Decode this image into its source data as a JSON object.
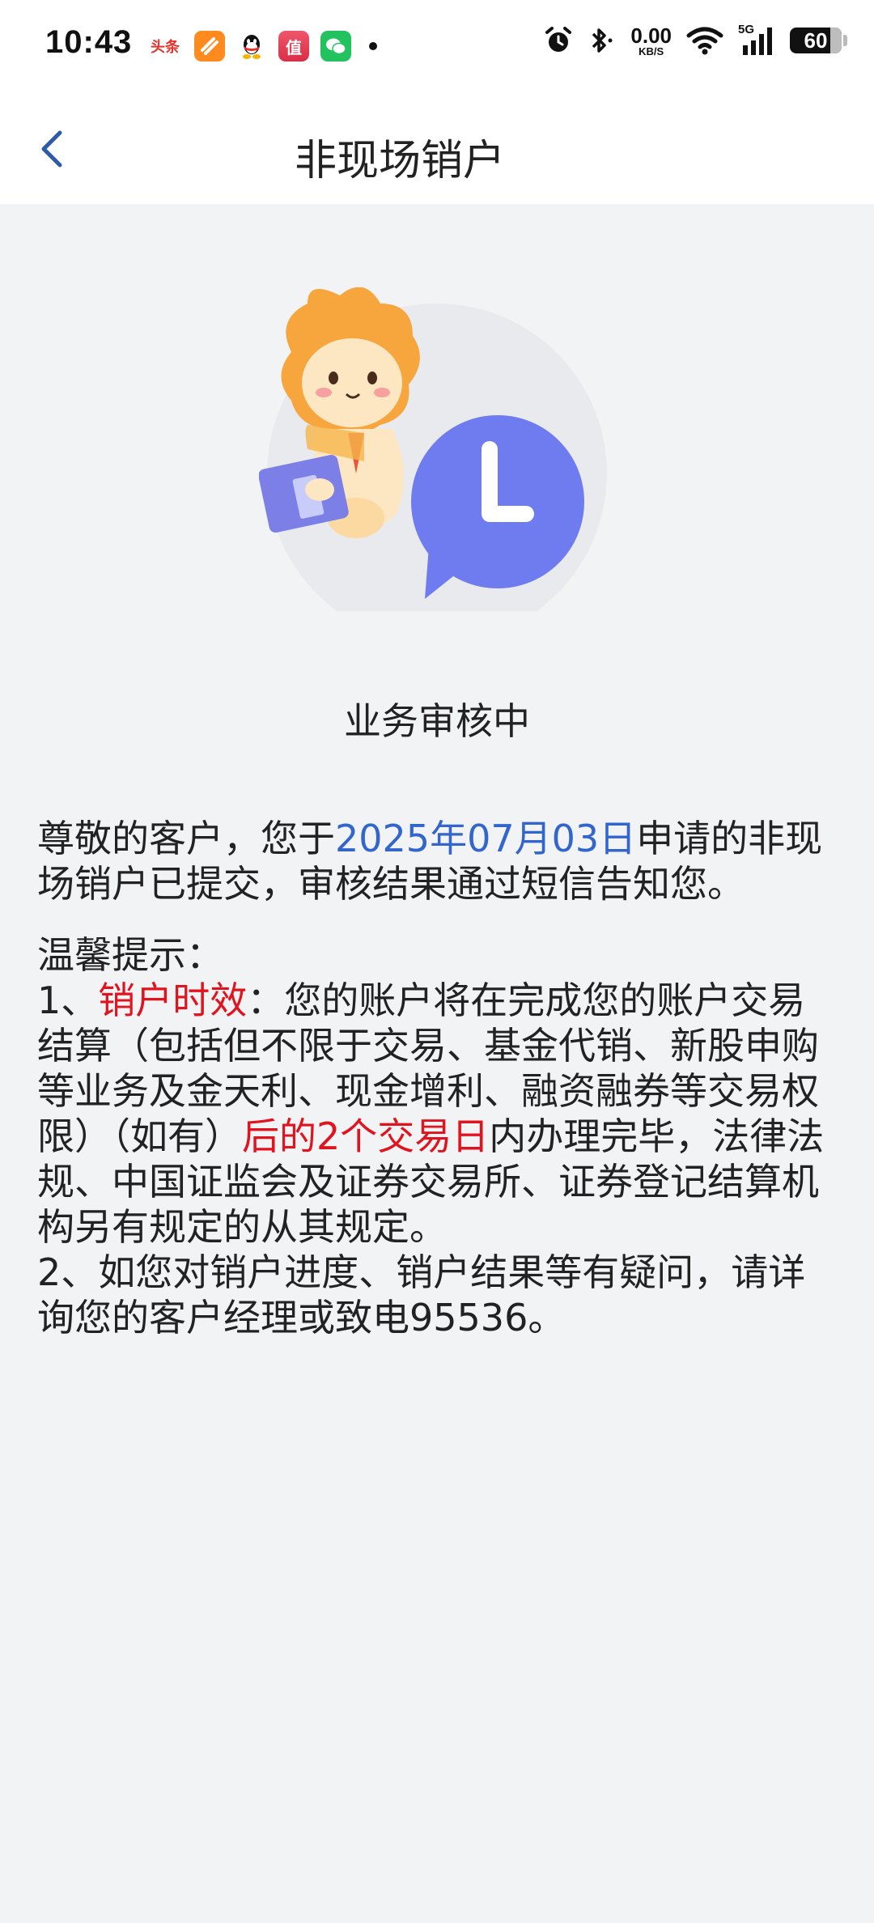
{
  "status_bar": {
    "time": "10:43",
    "apps": [
      {
        "name": "toutiao-app-icon",
        "label": "头条",
        "color": "#e8332b"
      },
      {
        "name": "orange-app-icon",
        "label": "",
        "color": "#ff8a1e"
      },
      {
        "name": "qq-app-icon",
        "label": "",
        "color": "#ffffff"
      },
      {
        "name": "zhi-app-icon",
        "label": "值",
        "color": "#e8334b"
      },
      {
        "name": "wechat-app-icon",
        "label": "",
        "color": "#22c35e"
      }
    ],
    "net_speed_value": "0.00",
    "net_speed_unit": "KB/S",
    "signal_label": "5G",
    "battery": "60"
  },
  "nav": {
    "title": "非现场销户"
  },
  "status": {
    "text": "业务审核中"
  },
  "message": {
    "p1_prefix": "尊敬的客户，您于",
    "p1_date": "2025年07月03日",
    "p1_suffix": "申请的非现场销户已提交，审核结果通过短信告知您。",
    "tips_title": "温馨提示：",
    "tip1_num": "1、",
    "tip1_highlight": "销户时效",
    "tip1_mid": "：您的账户将在完成您的账户交易结算（包括但不限于交易、基金代销、新股申购等业务及金天利、现金增利、融资融券等交易权限）（如有）",
    "tip1_highlight2": "后的2个交易日",
    "tip1_suffix": "内办理完毕，法律法规、中国证监会及证券交易所、证券登记结算机构另有规定的从其规定。",
    "tip2": "2、如您对销户进度、销户结果等有疑问，请详询您的客户经理或致电95536。"
  },
  "colors": {
    "accent_blue": "#3366cc",
    "highlight_red": "#e0141e",
    "background": "#f2f3f5"
  }
}
